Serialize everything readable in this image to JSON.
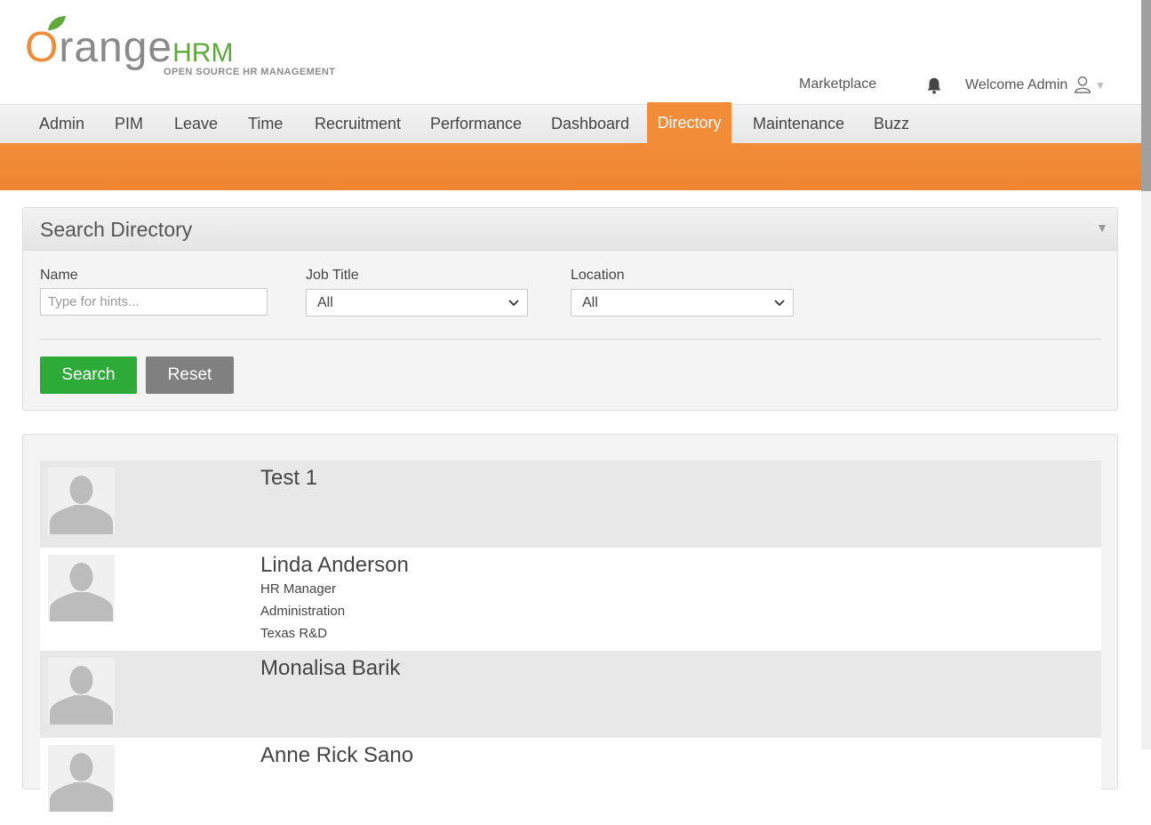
{
  "brand": {
    "logo_word": "range",
    "logo_o": "O",
    "logo_hrm": "HRM",
    "tagline": "OPEN SOURCE HR MANAGEMENT"
  },
  "header": {
    "marketplace": "Marketplace",
    "welcome": "Welcome Admin",
    "bell_icon": "bell-icon",
    "user_icon": "user-icon"
  },
  "nav": {
    "items": [
      {
        "label": "Admin"
      },
      {
        "label": "PIM"
      },
      {
        "label": "Leave"
      },
      {
        "label": "Time"
      },
      {
        "label": "Recruitment"
      },
      {
        "label": "Performance"
      },
      {
        "label": "Dashboard"
      },
      {
        "label": "Directory",
        "active": true
      },
      {
        "label": "Maintenance"
      },
      {
        "label": "Buzz"
      }
    ]
  },
  "search": {
    "title": "Search Directory",
    "name_label": "Name",
    "name_placeholder": "Type for hints...",
    "name_value": "",
    "job_title_label": "Job Title",
    "job_title_value": "All",
    "location_label": "Location",
    "location_value": "All",
    "search_button": "Search",
    "reset_button": "Reset"
  },
  "employees": [
    {
      "name": "Test 1"
    },
    {
      "name": "Linda Anderson",
      "job_title": "HR Manager",
      "department": "Administration",
      "location": "Texas R&D"
    },
    {
      "name": "Monalisa Barik"
    },
    {
      "name": "Anne Rick Sano"
    }
  ],
  "colors": {
    "brand_orange": "#f28c38",
    "brand_green": "#5daa3b",
    "search_button": "#2eaa39",
    "reset_button": "#808080"
  }
}
